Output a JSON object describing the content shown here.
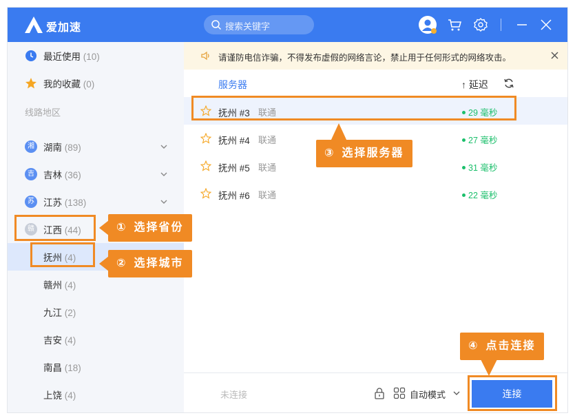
{
  "app": {
    "name": "爱加速"
  },
  "search": {
    "placeholder": "搜索关键字"
  },
  "titlebar_icons": [
    "avatar-icon",
    "cart-icon",
    "gear-icon",
    "minimize-icon",
    "close-icon"
  ],
  "sidebar": {
    "recent": {
      "label": "最近使用",
      "count": "(10)"
    },
    "favorites": {
      "label": "我的收藏",
      "count": "(0)"
    },
    "section_label": "线路地区",
    "provinces": [
      {
        "badge": "湘",
        "label": "湖南",
        "count": "(89)"
      },
      {
        "badge": "吉",
        "label": "吉林",
        "count": "(36)"
      },
      {
        "badge": "苏",
        "label": "江苏",
        "count": "(138)"
      },
      {
        "badge": "赣",
        "label": "江西",
        "count": "(44)"
      }
    ],
    "cities": [
      {
        "label": "抚州",
        "count": "(4)"
      },
      {
        "label": "赣州",
        "count": "(4)"
      },
      {
        "label": "九江",
        "count": "(2)"
      },
      {
        "label": "吉安",
        "count": "(4)"
      },
      {
        "label": "南昌",
        "count": "(18)"
      },
      {
        "label": "上饶",
        "count": "(4)"
      }
    ]
  },
  "notice": {
    "text": "请谨防电信诈骗，不得发布虚假的网络言论，禁止用于任何形式的网络攻击。"
  },
  "columns": {
    "servers": "服务器",
    "latency": "↑ 延迟"
  },
  "servers": [
    {
      "name": "抚州 #3",
      "isp": "联通",
      "ping": "29 毫秒"
    },
    {
      "name": "抚州 #4",
      "isp": "联通",
      "ping": "27 毫秒"
    },
    {
      "name": "抚州 #5",
      "isp": "联通",
      "ping": "31 毫秒"
    },
    {
      "name": "抚州 #6",
      "isp": "联通",
      "ping": "22 毫秒"
    }
  ],
  "bottom": {
    "status": "未连接",
    "mode": "自动模式",
    "connect": "连接"
  },
  "annotations": {
    "step1": {
      "num": "①",
      "text": "选择省份"
    },
    "step2": {
      "num": "②",
      "text": "选择城市"
    },
    "step3": {
      "num": "③",
      "text": "选择服务器"
    },
    "step4": {
      "num": "④",
      "text": "点击连接"
    }
  },
  "colors": {
    "brand": "#3a7bf0",
    "annotation": "#f08a24",
    "ping": "#1bbf6b",
    "notice_bg": "#fdf6e4"
  }
}
